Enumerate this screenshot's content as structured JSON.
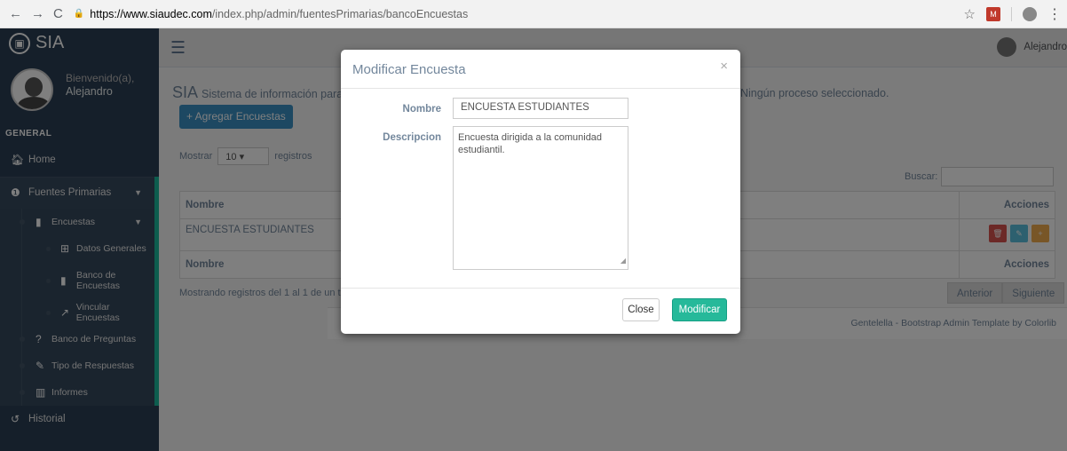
{
  "browser": {
    "back": "←",
    "forward": "→",
    "reload": "C",
    "url_host": "https://www.siaudec.com",
    "url_path": "/index.php/admin/fuentesPrimarias/bancoEncuestas"
  },
  "sidebar": {
    "brand": "SIA",
    "welcome": "Bienvenido(a),",
    "username": "Alejandro",
    "section": "GENERAL",
    "items": {
      "home": "Home",
      "fuentes": "Fuentes Primarias",
      "encuestas": "Encuestas",
      "datos_generales": "Datos Generales",
      "banco_encuestas": "Banco de Encuestas",
      "vincular": "Vincular Encuestas",
      "banco_preguntas": "Banco de Preguntas",
      "tipo_respuestas": "Tipo de Respuestas",
      "informes": "Informes",
      "historial": "Historial"
    }
  },
  "topbar": {
    "user": "Alejandro"
  },
  "main": {
    "sys_title": "SIA",
    "sys_subtitle": "Sistema de información para l",
    "sys_right": ". Ningún proceso seleccionado.",
    "add_button": "+ Agregar Encuestas",
    "mostrar": "Mostrar",
    "mostrar_value": "10",
    "registros": "registros",
    "buscar": "Buscar:",
    "table": {
      "col_nombre": "Nombre",
      "col_acciones": "Acciones",
      "rows": [
        {
          "nombre": "ENCUESTA ESTUDIANTES"
        }
      ]
    },
    "mostrando": "Mostrando registros del 1 al 1 de un total",
    "pag_prev": "Anterior",
    "pag_next": "Siguiente",
    "footer": "Gentelella - Bootstrap Admin Template by Colorlib"
  },
  "modal": {
    "title": "Modificar Encuesta",
    "close_x": "×",
    "nombre_label": "Nombre",
    "nombre_value": "ENCUESTA ESTUDIANTES",
    "descripcion_label": "Descripcion",
    "descripcion_value": "Encuesta dirigida a la comunidad estudiantil.",
    "close_button": "Close",
    "submit_button": "Modificar"
  },
  "colors": {
    "sidebar_bg": "#2a3f54",
    "accent_green": "#26B99A",
    "primary_blue": "#3a91c5",
    "danger_red": "#d9534f",
    "info_blue": "#5bc0de",
    "warning_orange": "#f0ad4e"
  }
}
